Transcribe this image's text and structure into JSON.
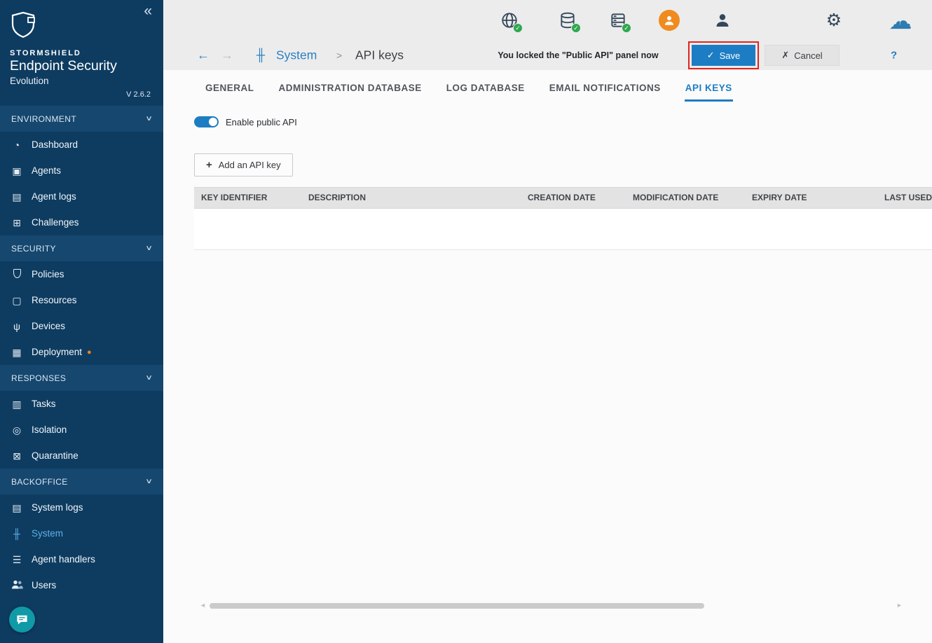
{
  "colors": {
    "accent_blue": "#1d7dc2",
    "sidebar_bg": "#0e3c61",
    "active_item_blue": "#5cb0e6",
    "status_green": "#2fa84f",
    "notification_orange": "#f08019",
    "annotation_red": "#e3231c"
  },
  "glyphs": {
    "collapse": "«",
    "chevron_down": "∨",
    "back": "←",
    "forward": "→",
    "sliders": "╫",
    "separator": ">",
    "check": "✓",
    "cross": "✗",
    "plus": "+",
    "dot": "●",
    "gear": "⚙",
    "cloud": "☁",
    "up_arrow": "↑",
    "scroll_left": "◄",
    "scroll_right": "►",
    "dashboard": "◔",
    "agents": "▣",
    "agent_logs": "▤",
    "challenges": "⊞",
    "resources": "▢",
    "devices": "ψ",
    "deployment": "▦",
    "tasks": "▥",
    "isolation": "◎",
    "quarantine": "⊠",
    "system_logs": "▤",
    "system": "╫",
    "agent_handlers": "☰",
    "help": "?"
  },
  "sidebar": {
    "brand": {
      "name": "STORMSHIELD",
      "product": "Endpoint Security",
      "edition": "Evolution",
      "version": "V 2.6.2"
    },
    "sections": [
      {
        "label": "ENVIRONMENT",
        "items": [
          {
            "label": "Dashboard",
            "icon": "dashboard-icon"
          },
          {
            "label": "Agents",
            "icon": "agents-icon"
          },
          {
            "label": "Agent logs",
            "icon": "agent-logs-icon"
          },
          {
            "label": "Challenges",
            "icon": "challenges-icon"
          }
        ]
      },
      {
        "label": "SECURITY",
        "items": [
          {
            "label": "Policies",
            "icon": "shield-icon"
          },
          {
            "label": "Resources",
            "icon": "resources-icon"
          },
          {
            "label": "Devices",
            "icon": "devices-icon"
          },
          {
            "label": "Deployment",
            "icon": "deployment-icon",
            "badge": "●"
          }
        ]
      },
      {
        "label": "RESPONSES",
        "items": [
          {
            "label": "Tasks",
            "icon": "tasks-icon"
          },
          {
            "label": "Isolation",
            "icon": "isolation-icon"
          },
          {
            "label": "Quarantine",
            "icon": "quarantine-icon"
          }
        ]
      },
      {
        "label": "BACKOFFICE",
        "items": [
          {
            "label": "System logs",
            "icon": "system-logs-icon"
          },
          {
            "label": "System",
            "icon": "system-icon",
            "active": true
          },
          {
            "label": "Agent handlers",
            "icon": "agent-handlers-icon"
          },
          {
            "label": "Users",
            "icon": "users-icon"
          }
        ]
      }
    ]
  },
  "topbar": {
    "icons": [
      {
        "name": "web-status-icon",
        "status": "ok"
      },
      {
        "name": "database-status-icon",
        "status": "ok"
      },
      {
        "name": "server-status-icon",
        "status": "ok"
      },
      {
        "name": "session-user-icon"
      },
      {
        "name": "user-icon"
      },
      {
        "name": "settings-gear-icon"
      },
      {
        "name": "cloud-icon"
      }
    ]
  },
  "actionbar": {
    "breadcrumb": {
      "root": "System",
      "separator": ">",
      "current": "API keys"
    },
    "notice": "You locked the \"Public API\" panel now",
    "save_label": "Save",
    "cancel_label": "Cancel"
  },
  "tabs": [
    {
      "label": "GENERAL"
    },
    {
      "label": "ADMINISTRATION DATABASE"
    },
    {
      "label": "LOG DATABASE"
    },
    {
      "label": "EMAIL NOTIFICATIONS"
    },
    {
      "label": "API KEYS",
      "active": true
    }
  ],
  "content": {
    "toggle": {
      "label": "Enable public API",
      "state": "on"
    },
    "add_button_label": "Add an API key",
    "table": {
      "columns": [
        "KEY IDENTIFIER",
        "DESCRIPTION",
        "CREATION DATE",
        "MODIFICATION DATE",
        "EXPIRY DATE",
        "LAST USED"
      ],
      "rows": []
    }
  }
}
